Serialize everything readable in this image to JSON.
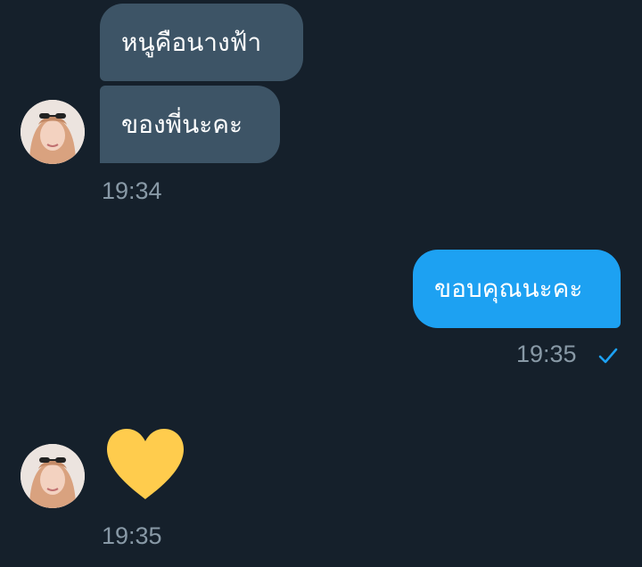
{
  "messages": [
    {
      "sender": "them",
      "text": "หนูคือนางฟ้า"
    },
    {
      "sender": "them",
      "text": "ของพี่นะคะ",
      "time": "19:34"
    },
    {
      "sender": "me",
      "text": "ขอบคุณนะคะ",
      "time": "19:35",
      "status_icon": "check-icon"
    },
    {
      "sender": "them",
      "type": "emoji",
      "emoji": "yellow-heart",
      "time": "19:35"
    }
  ],
  "colors": {
    "background": "#15202b",
    "incoming_bubble": "#3d5466",
    "outgoing_bubble": "#1da1f2",
    "timestamp": "#8899a6",
    "heart": "#ffcc4d",
    "check": "#1da1f2"
  }
}
